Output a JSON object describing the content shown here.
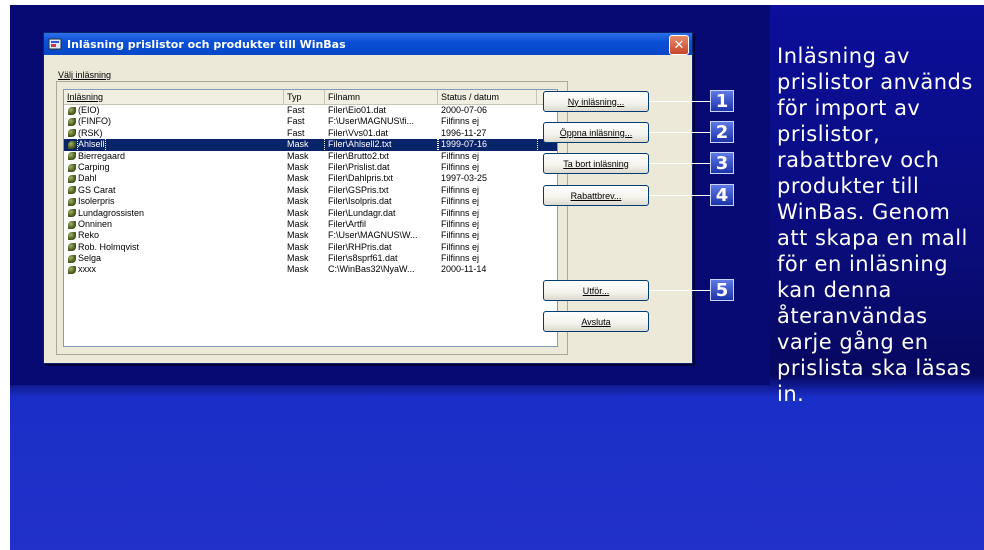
{
  "dialog": {
    "title": "Inläsning prislistor och produkter till WinBas",
    "group_label": "Välj inläsning",
    "columns": [
      "Inläsning",
      "Typ",
      "Filnamn",
      "Status / datum"
    ],
    "rows": [
      {
        "name": "(EIO)",
        "type": "Fast",
        "file": "Filer\\Eio01.dat",
        "status": "2000-07-06"
      },
      {
        "name": "(FINFO)",
        "type": "Fast",
        "file": "F:\\User\\MAGNUS\\fi...",
        "status": "Filfinns ej"
      },
      {
        "name": "(RSK)",
        "type": "Fast",
        "file": "Filer\\Vvs01.dat",
        "status": "1996-11-27"
      },
      {
        "name": "Ahlsell",
        "type": "Mask",
        "file": "Filer\\Ahlsell2.txt",
        "status": "1999-07-16",
        "selected": true
      },
      {
        "name": "Bierregaard",
        "type": "Mask",
        "file": "Filer\\Brutto2.txt",
        "status": "Filfinns ej"
      },
      {
        "name": "Carping",
        "type": "Mask",
        "file": "Filer\\Prislist.dat",
        "status": "Filfinns ej"
      },
      {
        "name": "Dahl",
        "type": "Mask",
        "file": "Filer\\Dahlpris.txt",
        "status": "1997-03-25"
      },
      {
        "name": "GS Carat",
        "type": "Mask",
        "file": "Filer\\GSPris.txt",
        "status": "Filfinns ej"
      },
      {
        "name": "Isolerpris",
        "type": "Mask",
        "file": "Filer\\Isolpris.dat",
        "status": "Filfinns ej"
      },
      {
        "name": "Lundagrossisten",
        "type": "Mask",
        "file": "Filer\\Lundagr.dat",
        "status": "Filfinns ej"
      },
      {
        "name": "Onninen",
        "type": "Mask",
        "file": "Filer\\Artfil",
        "status": "Filfinns ej"
      },
      {
        "name": "Reko",
        "type": "Mask",
        "file": "F:\\User\\MAGNUS\\W...",
        "status": "Filfinns ej"
      },
      {
        "name": "Rob. Holmqvist",
        "type": "Mask",
        "file": "Filer\\RHPris.dat",
        "status": "Filfinns ej"
      },
      {
        "name": "Selga",
        "type": "Mask",
        "file": "Filer\\s8sprf61.dat",
        "status": "Filfinns ej"
      },
      {
        "name": "xxxx",
        "type": "Mask",
        "file": "C:\\WinBas32\\NyaW...",
        "status": "2000-11-14"
      }
    ],
    "buttons": {
      "new": "Ny inläsning...",
      "open": "Öppna inläsning...",
      "delete": "Ta bort inläsning",
      "discount": "Rabattbrev...",
      "run": "Utför...",
      "close": "Avsluta"
    },
    "close_glyph": "✕"
  },
  "callouts": [
    "1",
    "2",
    "3",
    "4",
    "5"
  ],
  "description": "Inläsning av prislistor används för import av prislistor, rabattbrev och produkter till WinBas. Genom att skapa en mall för en inläsning kan denna återanvändas varje gång en prislista ska läsas in."
}
